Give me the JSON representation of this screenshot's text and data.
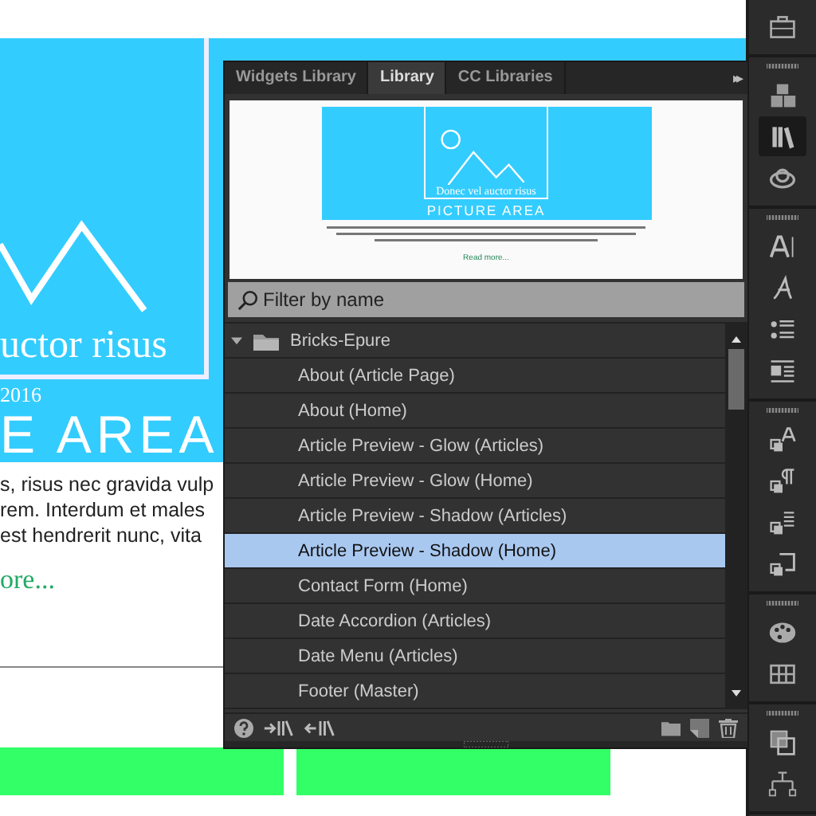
{
  "page": {
    "image_title": "uctor risus",
    "date": "2016",
    "picture_title": "E AREA",
    "body_lines": [
      "s, risus nec gravida vulp",
      "rem. Interdum et males",
      "est hendrerit nunc, vita"
    ],
    "read_more": "ore..."
  },
  "panel": {
    "tabs": [
      {
        "label": "Widgets Library",
        "selected": false
      },
      {
        "label": "Library",
        "selected": true
      },
      {
        "label": "CC Libraries",
        "selected": false
      }
    ],
    "menu_glyph": "▸▸",
    "preview": {
      "image_title": "Donec vel auctor risus",
      "picture_title": "PICTURE AREA",
      "read_more": "Read more..."
    },
    "search": {
      "placeholder": "Filter by name"
    },
    "tree": [
      {
        "label": "Bricks-Epure",
        "expanded": true,
        "children": [
          {
            "label": "About (Article Page)",
            "selected": false
          },
          {
            "label": "About (Home)",
            "selected": false
          },
          {
            "label": "Article Preview - Glow (Articles)",
            "selected": false
          },
          {
            "label": "Article Preview - Glow (Home)",
            "selected": false
          },
          {
            "label": "Article Preview - Shadow (Articles)",
            "selected": false
          },
          {
            "label": "Article Preview - Shadow (Home)",
            "selected": true
          },
          {
            "label": "Contact Form (Home)",
            "selected": false
          },
          {
            "label": "Date Accordion (Articles)",
            "selected": false
          },
          {
            "label": "Date Menu (Articles)",
            "selected": false
          },
          {
            "label": "Footer (Master)",
            "selected": false
          }
        ]
      }
    ]
  },
  "toolbar": {
    "groups": [
      {
        "tools": [
          {
            "kind": "briefcase",
            "selected": false
          }
        ]
      },
      {
        "tools": [
          {
            "kind": "blocks",
            "selected": false
          },
          {
            "kind": "library",
            "selected": true
          },
          {
            "kind": "cloud",
            "selected": false
          }
        ]
      },
      {
        "tools": [
          {
            "kind": "text",
            "selected": false
          },
          {
            "kind": "script",
            "selected": false
          },
          {
            "kind": "bullets",
            "selected": false
          },
          {
            "kind": "paragraph",
            "selected": false
          }
        ]
      },
      {
        "tools": [
          {
            "kind": "text-style",
            "selected": false
          },
          {
            "kind": "para-style",
            "selected": false
          },
          {
            "kind": "list-style",
            "selected": false
          },
          {
            "kind": "object-style",
            "selected": false
          }
        ]
      },
      {
        "tools": [
          {
            "kind": "palette",
            "selected": false
          },
          {
            "kind": "grid",
            "selected": false
          }
        ]
      },
      {
        "tools": [
          {
            "kind": "swatches",
            "selected": false
          },
          {
            "kind": "tree",
            "selected": false
          }
        ]
      }
    ]
  }
}
